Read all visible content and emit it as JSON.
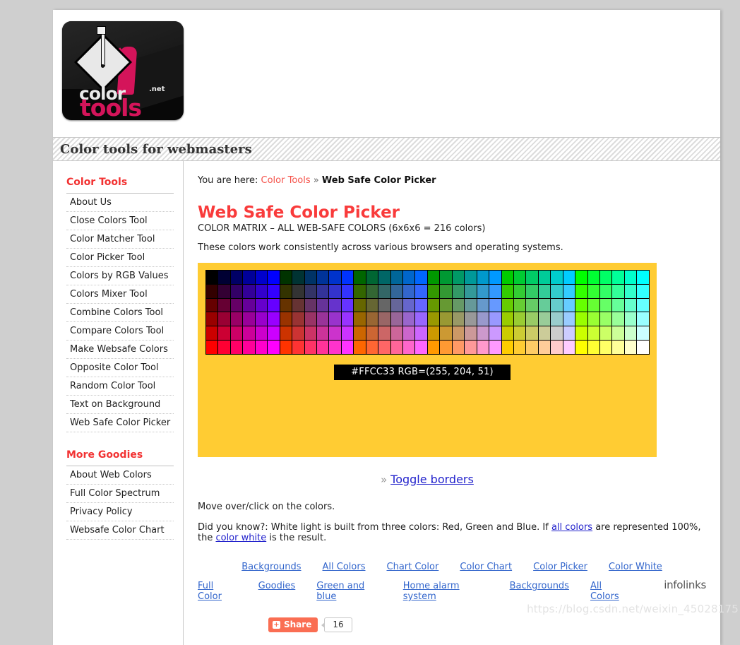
{
  "site": {
    "logo": {
      "word_primary": "color",
      "word_secondary": "tools",
      "tld": ".net",
      "brand_pink": "#d4145a"
    },
    "band_title": "Color tools for webmasters"
  },
  "breadcrumb": {
    "prefix": "You are here:",
    "root_label": "Color Tools",
    "separator": "»",
    "current_label": "Web Safe Color Picker"
  },
  "sidebar": {
    "sections": [
      {
        "title": "Color Tools",
        "items": [
          {
            "label": "About Us"
          },
          {
            "label": "Close Colors Tool"
          },
          {
            "label": "Color Matcher Tool"
          },
          {
            "label": "Color Picker Tool"
          },
          {
            "label": "Colors by RGB Values"
          },
          {
            "label": "Colors Mixer Tool"
          },
          {
            "label": "Combine Colors Tool"
          },
          {
            "label": "Compare Colors Tool"
          },
          {
            "label": "Make Websafe Colors"
          },
          {
            "label": "Opposite Color Tool"
          },
          {
            "label": "Random Color Tool"
          },
          {
            "label": "Text on Background"
          },
          {
            "label": "Web Safe Color Picker"
          }
        ]
      },
      {
        "title": "More Goodies",
        "items": [
          {
            "label": "About Web Colors"
          },
          {
            "label": "Full Color Spectrum"
          },
          {
            "label": "Privacy Policy"
          },
          {
            "label": "Websafe Color Chart"
          }
        ]
      }
    ]
  },
  "main": {
    "title": "Web Safe Color Picker",
    "subtitle": "COLOR MATRIX – ALL WEB-SAFE COLORS (6x6x6 = 216 colors)",
    "intro": "These colors work consistently across various browsers and operating systems.",
    "panel_background": "#FFCC33",
    "readout": "#FFCC33  RGB=(255, 204, 51)",
    "readout_hex": "#FFCC33",
    "readout_rgb": "RGB=(255, 204, 51)",
    "toggle": {
      "separator": "»",
      "label": "Toggle borders"
    },
    "notes": [
      "Move over/click on the colors.",
      "Did you know?: White light is built from three colors: Red, Green and Blue. If all colors are represented 100%, the color white is the result."
    ],
    "note2_parts": {
      "a": "Did you know?: White light is built from three colors: Red, Green and Blue. If ",
      "link1": "all colors",
      "b": " are represented 100%, the ",
      "link2": "color white",
      "c": " is the result."
    }
  },
  "footer": {
    "row1": [
      {
        "label": "Backgrounds"
      },
      {
        "label": "All Colors"
      },
      {
        "label": "Chart Color"
      },
      {
        "label": "Color Chart"
      },
      {
        "label": "Color Picker"
      },
      {
        "label": "Color White"
      }
    ],
    "row2": [
      {
        "label": "Full Color"
      },
      {
        "label": "Goodies"
      },
      {
        "label": "Green and blue"
      },
      {
        "label": "Home alarm system"
      },
      {
        "label": "Backgrounds"
      },
      {
        "label": "All Colors"
      }
    ],
    "ad_brand": "infolinks"
  },
  "share": {
    "icon": "plus-icon",
    "label": "Share",
    "count": "16"
  },
  "watermark": "https://blog.csdn.net/weixin_45028175",
  "chart_data": {
    "type": "heatmap",
    "title": "COLOR MATRIX – ALL WEB-SAFE COLORS (6x6x6 = 216 colors)",
    "rows": 6,
    "cols": 36,
    "levels": [
      "00",
      "33",
      "66",
      "99",
      "CC",
      "FF"
    ],
    "ordering": "row = red level (top 00 -> bottom FF); column group of 6 = green level (left 00 -> right FF); column within group = blue level (left 00 -> right FF)",
    "grid": [
      [
        "#000000",
        "#000033",
        "#000066",
        "#000099",
        "#0000CC",
        "#0000FF",
        "#003300",
        "#003333",
        "#003366",
        "#003399",
        "#0033CC",
        "#0033FF",
        "#006600",
        "#006633",
        "#006666",
        "#006699",
        "#0066CC",
        "#0066FF",
        "#009900",
        "#009933",
        "#009966",
        "#009999",
        "#0099CC",
        "#0099FF",
        "#00CC00",
        "#00CC33",
        "#00CC66",
        "#00CC99",
        "#00CCCC",
        "#00CCFF",
        "#00FF00",
        "#00FF33",
        "#00FF66",
        "#00FF99",
        "#00FFCC",
        "#00FFFF"
      ],
      [
        "#330000",
        "#330033",
        "#330066",
        "#330099",
        "#3300CC",
        "#3300FF",
        "#333300",
        "#333333",
        "#333366",
        "#333399",
        "#3333CC",
        "#3333FF",
        "#336600",
        "#336633",
        "#336666",
        "#336699",
        "#3366CC",
        "#3366FF",
        "#339900",
        "#339933",
        "#339966",
        "#339999",
        "#3399CC",
        "#3399FF",
        "#33CC00",
        "#33CC33",
        "#33CC66",
        "#33CC99",
        "#33CCCC",
        "#33CCFF",
        "#33FF00",
        "#33FF33",
        "#33FF66",
        "#33FF99",
        "#33FFCC",
        "#33FFFF"
      ],
      [
        "#660000",
        "#660033",
        "#660066",
        "#660099",
        "#6600CC",
        "#6600FF",
        "#663300",
        "#663333",
        "#663366",
        "#663399",
        "#6633CC",
        "#6633FF",
        "#666600",
        "#666633",
        "#666666",
        "#666699",
        "#6666CC",
        "#6666FF",
        "#669900",
        "#669933",
        "#669966",
        "#669999",
        "#6699CC",
        "#6699FF",
        "#66CC00",
        "#66CC33",
        "#66CC66",
        "#66CC99",
        "#66CCCC",
        "#66CCFF",
        "#66FF00",
        "#66FF33",
        "#66FF66",
        "#66FF99",
        "#66FFCC",
        "#66FFFF"
      ],
      [
        "#990000",
        "#990033",
        "#990066",
        "#990099",
        "#9900CC",
        "#9900FF",
        "#993300",
        "#993333",
        "#993366",
        "#993399",
        "#9933CC",
        "#9933FF",
        "#996600",
        "#996633",
        "#996666",
        "#996699",
        "#9966CC",
        "#9966FF",
        "#999900",
        "#999933",
        "#999966",
        "#999999",
        "#9999CC",
        "#9999FF",
        "#99CC00",
        "#99CC33",
        "#99CC66",
        "#99CC99",
        "#99CCCC",
        "#99CCFF",
        "#99FF00",
        "#99FF33",
        "#99FF66",
        "#99FF99",
        "#99FFCC",
        "#99FFFF"
      ],
      [
        "#CC0000",
        "#CC0033",
        "#CC0066",
        "#CC0099",
        "#CC00CC",
        "#CC00FF",
        "#CC3300",
        "#CC3333",
        "#CC3366",
        "#CC3399",
        "#CC33CC",
        "#CC33FF",
        "#CC6600",
        "#CC6633",
        "#CC6666",
        "#CC6699",
        "#CC66CC",
        "#CC66FF",
        "#CC9900",
        "#CC9933",
        "#CC9966",
        "#CC9999",
        "#CC99CC",
        "#CC99FF",
        "#CCCC00",
        "#CCCC33",
        "#CCCC66",
        "#CCCC99",
        "#CCCCCC",
        "#CCCCFF",
        "#CCFF00",
        "#CCFF33",
        "#CCFF66",
        "#CCFF99",
        "#CCFFCC",
        "#CCFFFF"
      ],
      [
        "#FF0000",
        "#FF0033",
        "#FF0066",
        "#FF0099",
        "#FF00CC",
        "#FF00FF",
        "#FF3300",
        "#FF3333",
        "#FF3366",
        "#FF3399",
        "#FF33CC",
        "#FF33FF",
        "#FF6600",
        "#FF6633",
        "#FF6666",
        "#FF6699",
        "#FF66CC",
        "#FF66FF",
        "#FF9900",
        "#FF9933",
        "#FF9966",
        "#FF9999",
        "#FF99CC",
        "#FF99FF",
        "#FFCC00",
        "#FFCC33",
        "#FFCC66",
        "#FFCC99",
        "#FFCCCC",
        "#FFCCFF",
        "#FFFF00",
        "#FFFF33",
        "#FFFF66",
        "#FFFF99",
        "#FFFFCC",
        "#FFFFFF"
      ]
    ]
  }
}
